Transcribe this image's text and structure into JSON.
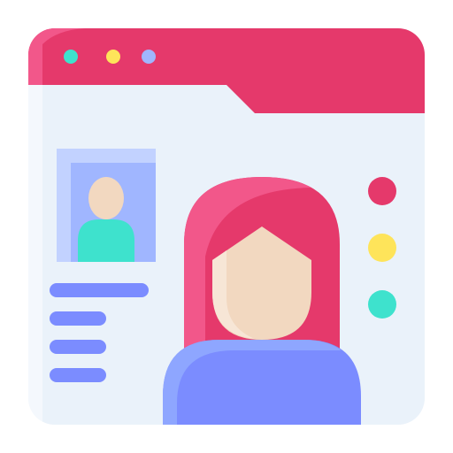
{
  "icon": {
    "name": "user-profile-webpage-icon"
  },
  "window": {
    "controls": [
      {
        "name": "window-control-dot",
        "color": "#3ee2cd"
      },
      {
        "name": "window-control-dot",
        "color": "#fee45a"
      },
      {
        "name": "window-control-dot",
        "color": "#a0b6ff"
      }
    ]
  },
  "status_dots": [
    {
      "name": "status-dot",
      "color": "#e5396b"
    },
    {
      "name": "status-dot",
      "color": "#fee45a"
    },
    {
      "name": "status-dot",
      "color": "#3ee2cd"
    }
  ],
  "colors": {
    "title_bar": "#e5396b",
    "title_bar_highlight": "#f2578a",
    "window_body": "#eaf2fa",
    "window_shadow": "#f4f8fd",
    "photo_frame": "#a0b6ff",
    "photo_inner": "#c2d2ff",
    "person_skin": "#f2d8c0",
    "person_shirt_small": "#3ee2cd",
    "hair": "#e5396b",
    "hair_highlight": "#f2578a",
    "face_shadow": "#f7e6d6",
    "shirt": "#7b8cff",
    "shirt_highlight": "#8ea6ff",
    "text_lines": "#7b8cff"
  }
}
